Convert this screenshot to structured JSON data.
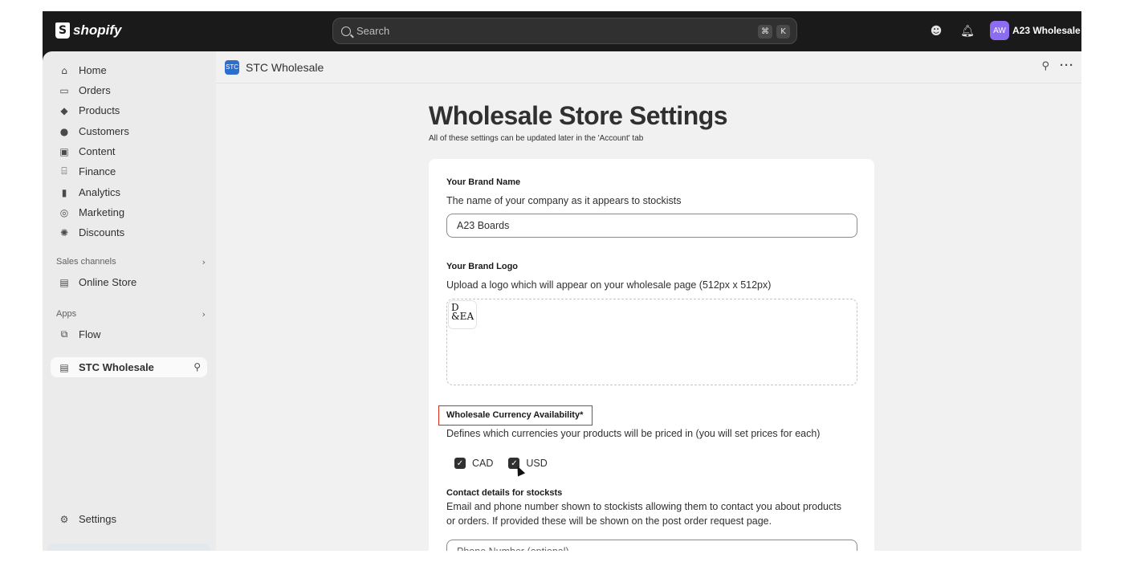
{
  "topbar": {
    "logo_text": "shopify",
    "search_placeholder": "Search",
    "shortcut_cmd": "⌘",
    "shortcut_key": "K",
    "avatar_initials": "AW",
    "store_name": "A23 Wholesale"
  },
  "sidebar": {
    "items": [
      {
        "label": "Home",
        "icon": "home-icon"
      },
      {
        "label": "Orders",
        "icon": "inbox-icon"
      },
      {
        "label": "Products",
        "icon": "tag-icon"
      },
      {
        "label": "Customers",
        "icon": "person-icon"
      },
      {
        "label": "Content",
        "icon": "image-icon"
      },
      {
        "label": "Finance",
        "icon": "bank-icon"
      },
      {
        "label": "Analytics",
        "icon": "bar-chart-icon"
      },
      {
        "label": "Marketing",
        "icon": "target-icon"
      },
      {
        "label": "Discounts",
        "icon": "discount-icon"
      }
    ],
    "sales_channels_label": "Sales channels",
    "online_store_label": "Online Store",
    "apps_label": "Apps",
    "flow_label": "Flow",
    "app_label": "STC Wholesale",
    "settings_label": "Settings"
  },
  "app_header": {
    "title": "STC Wholesale",
    "icon_text": "STC"
  },
  "page": {
    "title": "Wholesale Store Settings",
    "subtitle": "All of these settings can be updated later in the 'Account' tab",
    "brand_name": {
      "label": "Your Brand Name",
      "description": "The name of your company as it appears to stockists",
      "value": "A23 Boards"
    },
    "brand_logo": {
      "label": "Your Brand Logo",
      "description": "Upload a logo which will appear on your wholesale page (512px x 512px)"
    },
    "currency": {
      "label": "Wholesale Currency Availability*",
      "description": "Defines which currencies your products will be priced in (you will set prices for each)",
      "options": [
        {
          "label": "CAD",
          "checked": true
        },
        {
          "label": "USD",
          "checked": true
        }
      ]
    },
    "contact": {
      "label": "Contact details for stocksts",
      "description_line1": "Email and phone number shown to stockists allowing them to contact you about products",
      "description_line2": "or orders. If provided these will be shown on the post order request page.",
      "phone_placeholder": "Phone Number (optional)"
    }
  },
  "colors": {
    "accent_highlight": "#d72c0d",
    "avatar": "#8c6cf0",
    "app_icon": "#2c6ecb"
  }
}
